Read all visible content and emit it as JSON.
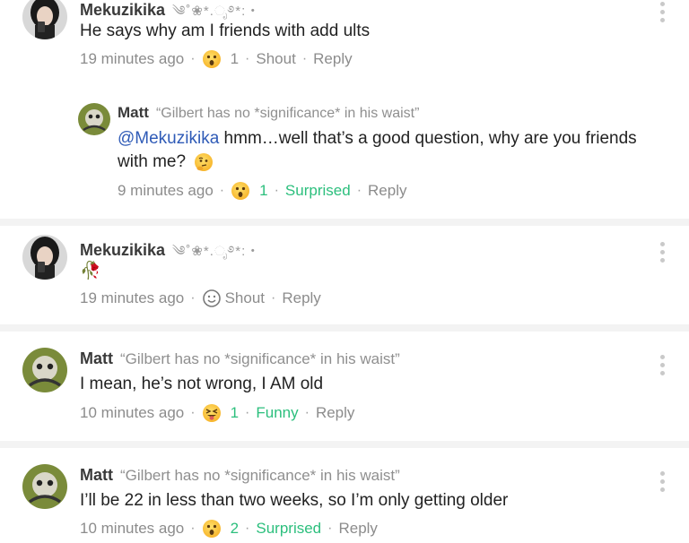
{
  "comments": [
    {
      "author": "Mekuzikika",
      "decoration": "༄˚❀*.ೃ࿔*:・",
      "text": "He says why am I friends with add ults",
      "time": "19 minutes ago",
      "reaction_count": "1",
      "reaction_label": "Shout",
      "reply_label": "Reply"
    },
    {
      "author": "Matt",
      "tagline": "“Gilbert has no *significance* in his waist”",
      "mention": "@Mekuzikika",
      "text": " hmm…well that’s a good question, why are you friends with me?",
      "time": "9 minutes ago",
      "reaction_count": "1",
      "reaction_label": "Surprised",
      "reply_label": "Reply"
    },
    {
      "author": "Mekuzikika",
      "decoration": "༄˚❀*.ೃ࿔*:・",
      "text": "🥀",
      "time": "19 minutes ago",
      "reaction_label": "Shout",
      "reply_label": "Reply"
    },
    {
      "author": "Matt",
      "tagline": "“Gilbert has no *significance* in his waist”",
      "text": "I mean, he’s not wrong, I AM old",
      "time": "10 minutes ago",
      "reaction_count": "1",
      "reaction_label": "Funny",
      "reply_label": "Reply"
    },
    {
      "author": "Matt",
      "tagline": "“Gilbert has no *significance* in his waist”",
      "text": "I’ll be 22 in less than two weeks, so I’m only getting older",
      "time": "10 minutes ago",
      "reaction_count": "2",
      "reaction_label": "Surprised",
      "reply_label": "Reply"
    }
  ],
  "colors": {
    "accent_green": "#2cbf7d",
    "mention_blue": "#2f5bb7",
    "separator": "#f3f3f3"
  },
  "icons": {
    "surprised": "surprised-face-icon",
    "funny": "squinting-tongue-face-icon",
    "thinking": "thinking-face-icon",
    "shout": "smiley-outline-icon",
    "menu": "vertical-dots-icon"
  }
}
